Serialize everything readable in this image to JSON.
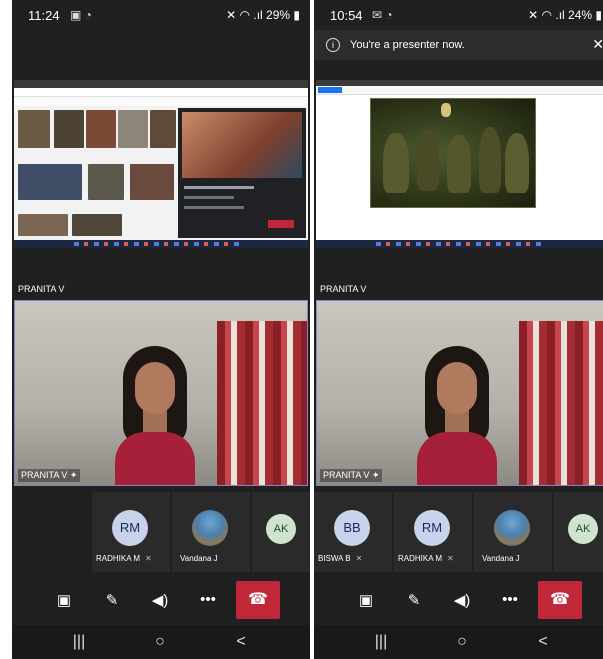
{
  "left": {
    "status": {
      "time": "11:24",
      "left_icons": "▣ ◔",
      "right": "✕ ◠ .ıl 29% ▮"
    },
    "presenter_name": "PRANITA V",
    "video_label": "PRANITA V ✦",
    "participants": [
      {
        "initials": "RM",
        "name": "RADHIKA M",
        "muted": true
      },
      {
        "initials": "",
        "name": "Vandana J",
        "muted": false,
        "photo": true
      },
      {
        "initials": "AK",
        "name": "",
        "muted": false
      }
    ]
  },
  "right": {
    "status": {
      "time": "10:54",
      "left_icons": "✉ ◔",
      "right": "✕ ◠ .ıl 24% ▮"
    },
    "banner": {
      "text": "You're a presenter now.",
      "close": "✕",
      "info": "i"
    },
    "presenter_name": "PRANITA V",
    "video_label": "PRANITA V ✦",
    "participants": [
      {
        "initials": "BB",
        "name": "BISWA B",
        "muted": true
      },
      {
        "initials": "RM",
        "name": "RADHIKA M",
        "muted": true
      },
      {
        "initials": "",
        "name": "Vandana J",
        "muted": false,
        "photo": true
      },
      {
        "initials": "AK",
        "name": "",
        "muted": false
      }
    ]
  },
  "controls": {
    "camera_icon": "▣",
    "mic_icon": "✎",
    "speaker_icon": "◀)",
    "more_label": "•••",
    "hangup_icon": "☎"
  },
  "nav": {
    "recents": "|||",
    "home": "○",
    "back": "<"
  },
  "colors": {
    "hangup": "#c0283a",
    "avatar_bg": "#c8d2ea",
    "avatar_text": "#1b2a57",
    "video_border": "#7f86c8"
  }
}
